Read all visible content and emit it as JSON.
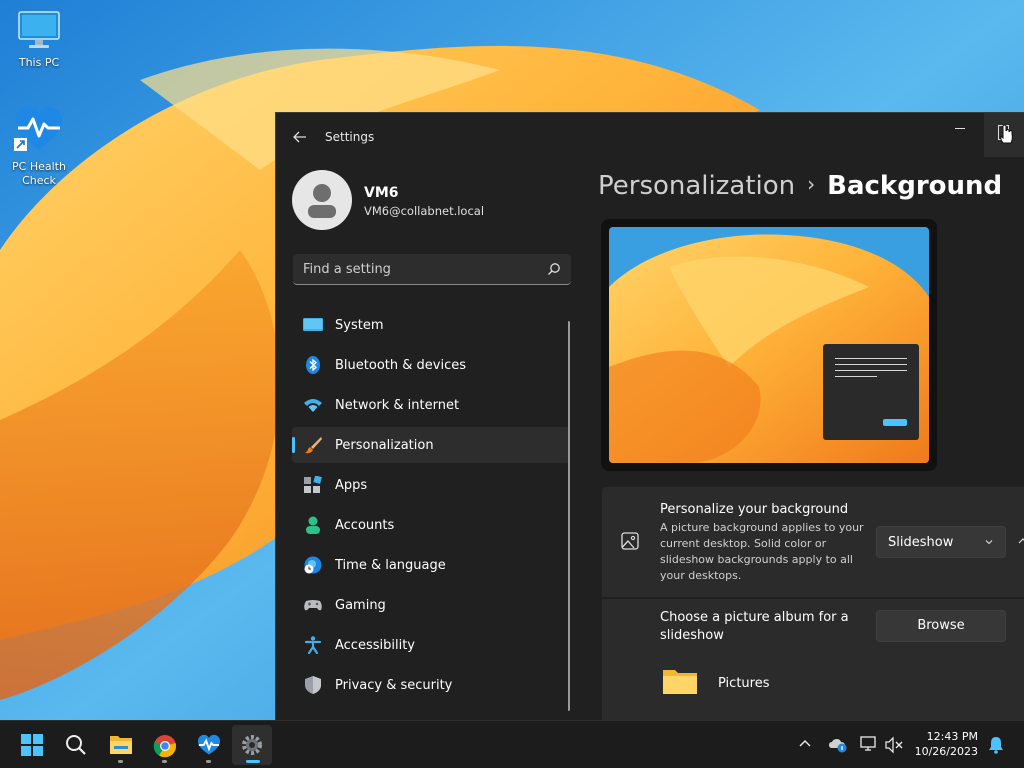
{
  "desktop": {
    "icons": [
      {
        "label": "This PC",
        "icon": "monitor-icon"
      },
      {
        "label": "PC Health Check",
        "icon": "heart-health-icon"
      }
    ]
  },
  "window": {
    "title": "Settings",
    "user": {
      "name": "VM6",
      "email": "VM6@collabnet.local"
    },
    "search": {
      "placeholder": "Find a setting"
    },
    "nav": [
      {
        "label": "System",
        "icon": "system-icon"
      },
      {
        "label": "Bluetooth & devices",
        "icon": "bluetooth-icon"
      },
      {
        "label": "Network & internet",
        "icon": "wifi-icon"
      },
      {
        "label": "Personalization",
        "icon": "brush-icon",
        "active": true
      },
      {
        "label": "Apps",
        "icon": "apps-icon"
      },
      {
        "label": "Accounts",
        "icon": "person-icon"
      },
      {
        "label": "Time & language",
        "icon": "globe-clock-icon"
      },
      {
        "label": "Gaming",
        "icon": "gamepad-icon"
      },
      {
        "label": "Accessibility",
        "icon": "accessibility-icon"
      },
      {
        "label": "Privacy & security",
        "icon": "shield-icon"
      }
    ],
    "breadcrumb": {
      "parent": "Personalization",
      "separator": "›",
      "current": "Background"
    },
    "personalize": {
      "title": "Personalize your background",
      "description": "A picture background applies to your current desktop. Solid color or slideshow backgrounds apply to all your desktops.",
      "selected": "Slideshow"
    },
    "album": {
      "title": "Choose a picture album for a slideshow",
      "button": "Browse",
      "folder": "Pictures"
    }
  },
  "taskbar": {
    "apps": [
      "start-icon",
      "search-icon",
      "file-explorer-icon",
      "chrome-icon",
      "pc-health-icon",
      "settings-icon"
    ],
    "time": "12:43 PM",
    "date": "10/26/2023"
  },
  "colors": {
    "accent": "#4cc2ff",
    "window_bg": "#202020",
    "card_bg": "#2b2b2b"
  }
}
